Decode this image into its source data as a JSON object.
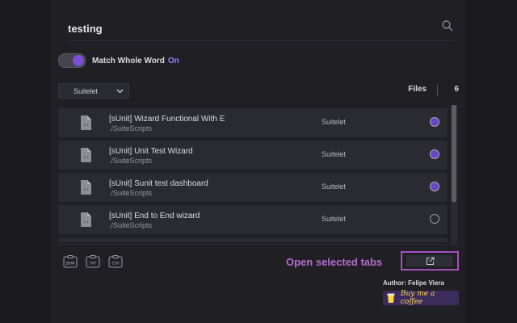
{
  "search": {
    "value": "testing",
    "placeholder": ""
  },
  "match_whole_word": {
    "label": "Match Whole Word",
    "state": "On"
  },
  "filter": {
    "selected": "Suitelet"
  },
  "files": {
    "label": "Files",
    "count": "6"
  },
  "results": [
    {
      "title": "[sUnit] Wizard Functional With E",
      "path": "./SuiteScripts",
      "type": "Suitelet",
      "selected": true
    },
    {
      "title": "[sUnit] Unit Test Wizard",
      "path": "./SuiteScripts",
      "type": "Suitelet",
      "selected": true
    },
    {
      "title": "[sUnit] Sunit test dashboard",
      "path": "./SuiteScripts",
      "type": "Suitelet",
      "selected": true
    },
    {
      "title": "[sUnit] End to End wizard",
      "path": "./SuiteScripts",
      "type": "Suitelet",
      "selected": false
    }
  ],
  "export": {
    "json": "JSON",
    "txt": "TXT",
    "csv": "CSV"
  },
  "open_tabs": {
    "label": "Open selected tabs"
  },
  "author": "Author: Felipe Viera",
  "coffee": {
    "label": "Buy me a coffee"
  },
  "colors": {
    "accent": "#7c4dd6",
    "highlight": "#b86ad0",
    "background": "#1f1f24"
  }
}
